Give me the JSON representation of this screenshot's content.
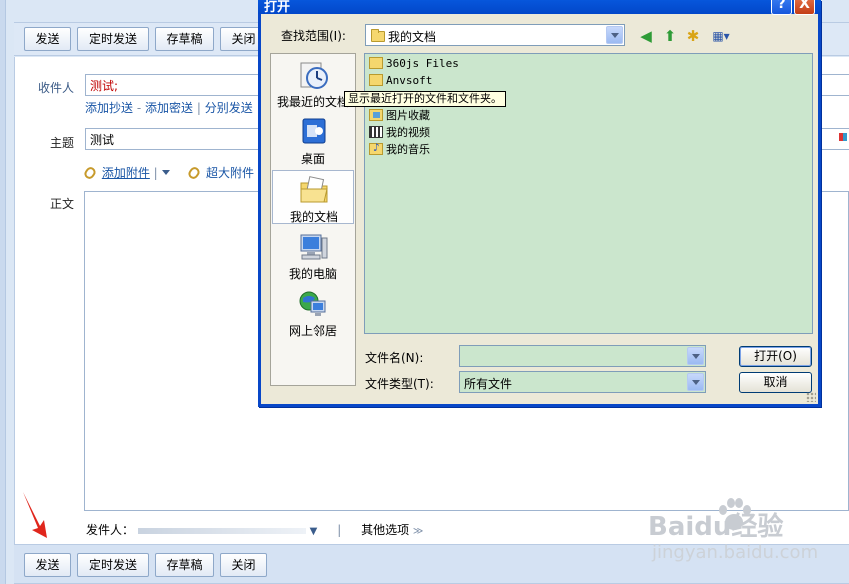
{
  "compose": {
    "toolbar": {
      "send": "发送",
      "scheduled_send": "定时发送",
      "save_draft": "存草稿",
      "close": "关闭"
    },
    "recipient_label": "收件人",
    "recipient_value": "测试;",
    "links": {
      "add_cc": "添加抄送",
      "add_bcc": "添加密送",
      "separate_send": "分别发送"
    },
    "subject_label": "主题",
    "subject_value": "测试",
    "add_attachment": "添加附件",
    "large_attachment": "超大附件",
    "body_label": "正文",
    "sender_label": "发件人：",
    "more_options": "其他选项"
  },
  "dialog": {
    "title": "打开",
    "help_btn": "?",
    "close_btn": "X",
    "look_in_label": "查找范围(I):",
    "look_in_value": "我的文档",
    "places": [
      {
        "label": "我最近的文档",
        "icon": "recent-documents-icon"
      },
      {
        "label": "桌面",
        "icon": "desktop-icon"
      },
      {
        "label": "我的文档",
        "icon": "my-documents-icon"
      },
      {
        "label": "我的电脑",
        "icon": "my-computer-icon"
      },
      {
        "label": "网上邻居",
        "icon": "network-places-icon"
      }
    ],
    "tooltip": "显示最近打开的文件和文件夹。",
    "files": [
      {
        "name": "360js Files",
        "icon": "folder-icon"
      },
      {
        "name": "Anvsoft",
        "icon": "folder-icon"
      },
      {
        "name": "图片收藏",
        "icon": "pictures-folder-icon"
      },
      {
        "name": "我的视频",
        "icon": "video-folder-icon"
      },
      {
        "name": "我的音乐",
        "icon": "music-folder-icon"
      }
    ],
    "filename_label": "文件名(N):",
    "filename_value": "",
    "filetype_label": "文件类型(T):",
    "filetype_value": "所有文件",
    "open_btn": "打开(O)",
    "cancel_btn": "取消"
  },
  "watermark": {
    "brand": "Baidu经验",
    "url": "jingyan.baidu.com"
  },
  "colors": {
    "accent_blue": "#0847c8",
    "list_green": "#cbe6cd",
    "red_arrow": "#e0261c"
  }
}
